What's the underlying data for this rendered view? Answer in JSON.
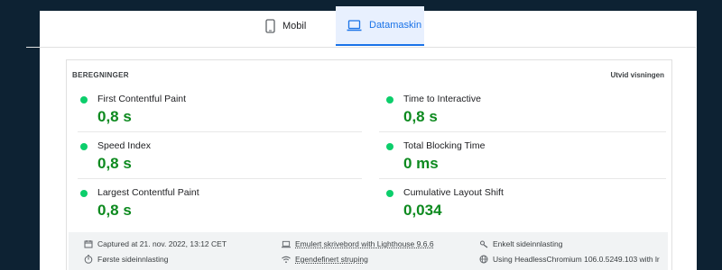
{
  "tabs": [
    {
      "label": "Mobil",
      "icon": "phone-icon",
      "active": false
    },
    {
      "label": "Datamaskin",
      "icon": "laptop-icon",
      "active": true
    }
  ],
  "section": {
    "title": "BEREGNINGER",
    "expand_label": "Utvid visningen"
  },
  "metrics": [
    {
      "label": "First Contentful Paint",
      "value": "0,8 s",
      "status": "good"
    },
    {
      "label": "Time to Interactive",
      "value": "0,8 s",
      "status": "good"
    },
    {
      "label": "Speed Index",
      "value": "0,8 s",
      "status": "good"
    },
    {
      "label": "Total Blocking Time",
      "value": "0 ms",
      "status": "good"
    },
    {
      "label": "Largest Contentful Paint",
      "value": "0,8 s",
      "status": "good"
    },
    {
      "label": "Cumulative Layout Shift",
      "value": "0,034",
      "status": "good"
    }
  ],
  "info": [
    {
      "icon": "calendar-icon",
      "text": "Captured at 21. nov. 2022, 13:12 CET"
    },
    {
      "icon": "laptop-icon",
      "text": "Emulert skrivebord with Lighthouse 9.6.6"
    },
    {
      "icon": "single-page-icon",
      "text": "Enkelt sideinnlasting"
    },
    {
      "icon": "timer-icon",
      "text": "Første sideinnlasting"
    },
    {
      "icon": "wifi-icon",
      "text": "Egendefinert struping"
    },
    {
      "icon": "globe-icon",
      "text": "Using HeadlessChromium 106.0.5249.103 with lr"
    }
  ],
  "colors": {
    "good": "#0cce6b",
    "good_text": "#0d8a1f",
    "accent": "#1a73e8",
    "frame_bg": "#0d2233"
  }
}
